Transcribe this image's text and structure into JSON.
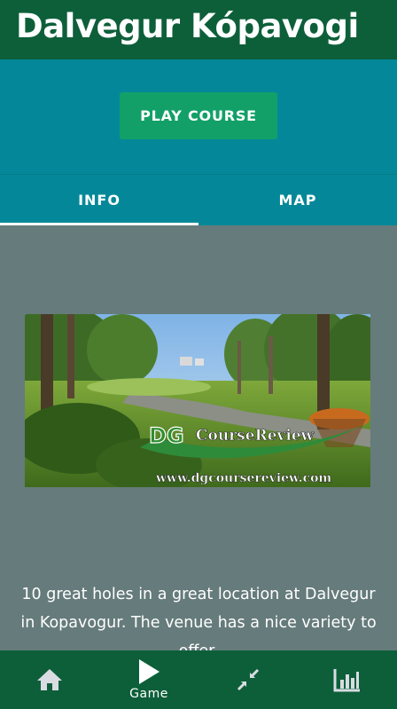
{
  "header": {
    "title": "Dalvegur Kópavogi"
  },
  "play": {
    "label": "PLAY COURSE"
  },
  "tabs": [
    {
      "label": "INFO",
      "active": true
    },
    {
      "label": "MAP",
      "active": false
    }
  ],
  "content": {
    "image": {
      "logo_text": "DGCourseReview",
      "url_text": "www.dgcoursereview.com"
    },
    "description": "10 great holes in a great location at Dalvegur in Kopavogur. The venue has a nice variety to offer."
  },
  "bottom_nav": [
    {
      "icon": "home-icon",
      "label": ""
    },
    {
      "icon": "play-icon",
      "label": "Game"
    },
    {
      "icon": "compress-icon",
      "label": ""
    },
    {
      "icon": "bar-chart-icon",
      "label": ""
    }
  ],
  "colors": {
    "header_bg": "#0d5f3a",
    "teal_bg": "#048899",
    "play_button": "#12a068",
    "content_bg": "#667b7b"
  }
}
